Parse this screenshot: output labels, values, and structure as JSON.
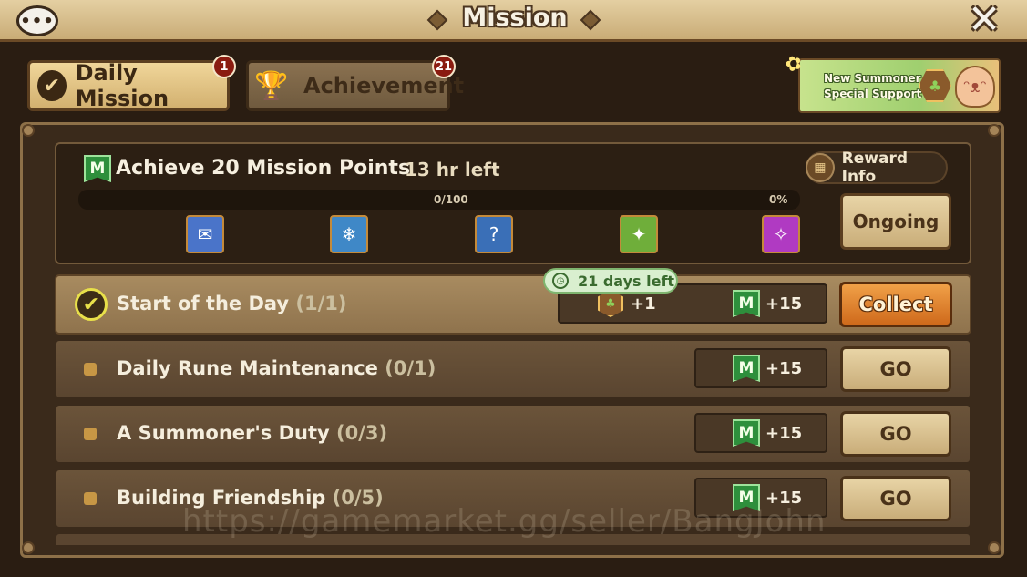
{
  "header": {
    "title": "Mission",
    "chat_icon": "chat-bubble-icon",
    "close_icon": "close-icon",
    "chat_dots": "•••",
    "close_glyph": "✕"
  },
  "tabs": [
    {
      "label": "Daily Mission",
      "badge": "1",
      "icon": "check-icon",
      "glyph": "✔"
    },
    {
      "label": "Achievement",
      "badge": "21",
      "icon": "trophy-icon",
      "glyph": "🏆"
    }
  ],
  "promo": {
    "line1": "New Summoner",
    "line2": "Special Support",
    "hex_glyph": "♣",
    "mascot_glyph": "ᵔᴥᵔ",
    "butterfly_glyph": "✿"
  },
  "points": {
    "title": "Achieve 20 Mission Points",
    "time_left": "13 hr left",
    "progress_text": "0/100",
    "percent_text": "0%",
    "progress_fraction": 0,
    "reward_info_label": "Reward Info",
    "reward_info_glyph": "▦",
    "ongoing_label": "Ongoing",
    "m_glyph": "M",
    "rewards": [
      {
        "icon": "blue-scroll-icon",
        "glyph": "✉",
        "color": "#4a74c9"
      },
      {
        "icon": "ice-scroll-icon",
        "glyph": "❄",
        "color": "#3f88c7"
      },
      {
        "icon": "mystery-scroll-icon",
        "glyph": "?",
        "color": "#3a6fb7"
      },
      {
        "icon": "summon-scroll-icon",
        "glyph": "✦",
        "color": "#6fae3a"
      },
      {
        "icon": "devilmon-scroll-icon",
        "glyph": "✧",
        "color": "#b03ac2"
      }
    ]
  },
  "missions": [
    {
      "title": "Start of the Day",
      "progress": "(1/1)",
      "completed": true,
      "days_left": "21 days left",
      "clock_glyph": "◷",
      "check_glyph": "✔",
      "hex_glyph": "♣",
      "item_reward": "+1",
      "points_reward": "+15",
      "action_label": "Collect"
    },
    {
      "title": "Daily Rune Maintenance",
      "progress": "(0/1)",
      "completed": false,
      "points_reward": "+15",
      "action_label": "GO"
    },
    {
      "title": "A Summoner's Duty",
      "progress": "(0/3)",
      "completed": false,
      "points_reward": "+15",
      "action_label": "GO"
    },
    {
      "title": "Building Friendship",
      "progress": "(0/5)",
      "completed": false,
      "points_reward": "+15",
      "action_label": "GO"
    }
  ],
  "watermark": "https://gamemarket.gg/seller/BangJohn"
}
